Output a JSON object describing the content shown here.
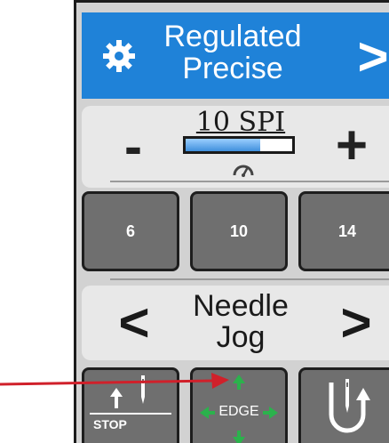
{
  "mode": {
    "title": "Regulated",
    "subtitle": "Precise",
    "next": ">",
    "icon": "gear-icon"
  },
  "stitch": {
    "label": "10 SPI",
    "minus": "-",
    "plus": "+",
    "level": 0.7,
    "gauge_icon": "speedometer-icon"
  },
  "presets": [
    "6",
    "10",
    "14"
  ],
  "jog": {
    "title": "Needle",
    "subtitle": "Jog",
    "prev": "<",
    "next": ">"
  },
  "functions": {
    "stop_label": "STOP",
    "edge_label": "EDGE"
  },
  "colors": {
    "topbar": "#1f82d8",
    "key": "#6f6f6f",
    "edge_arrows": "#2bb24c",
    "pointer": "#d0202a"
  }
}
